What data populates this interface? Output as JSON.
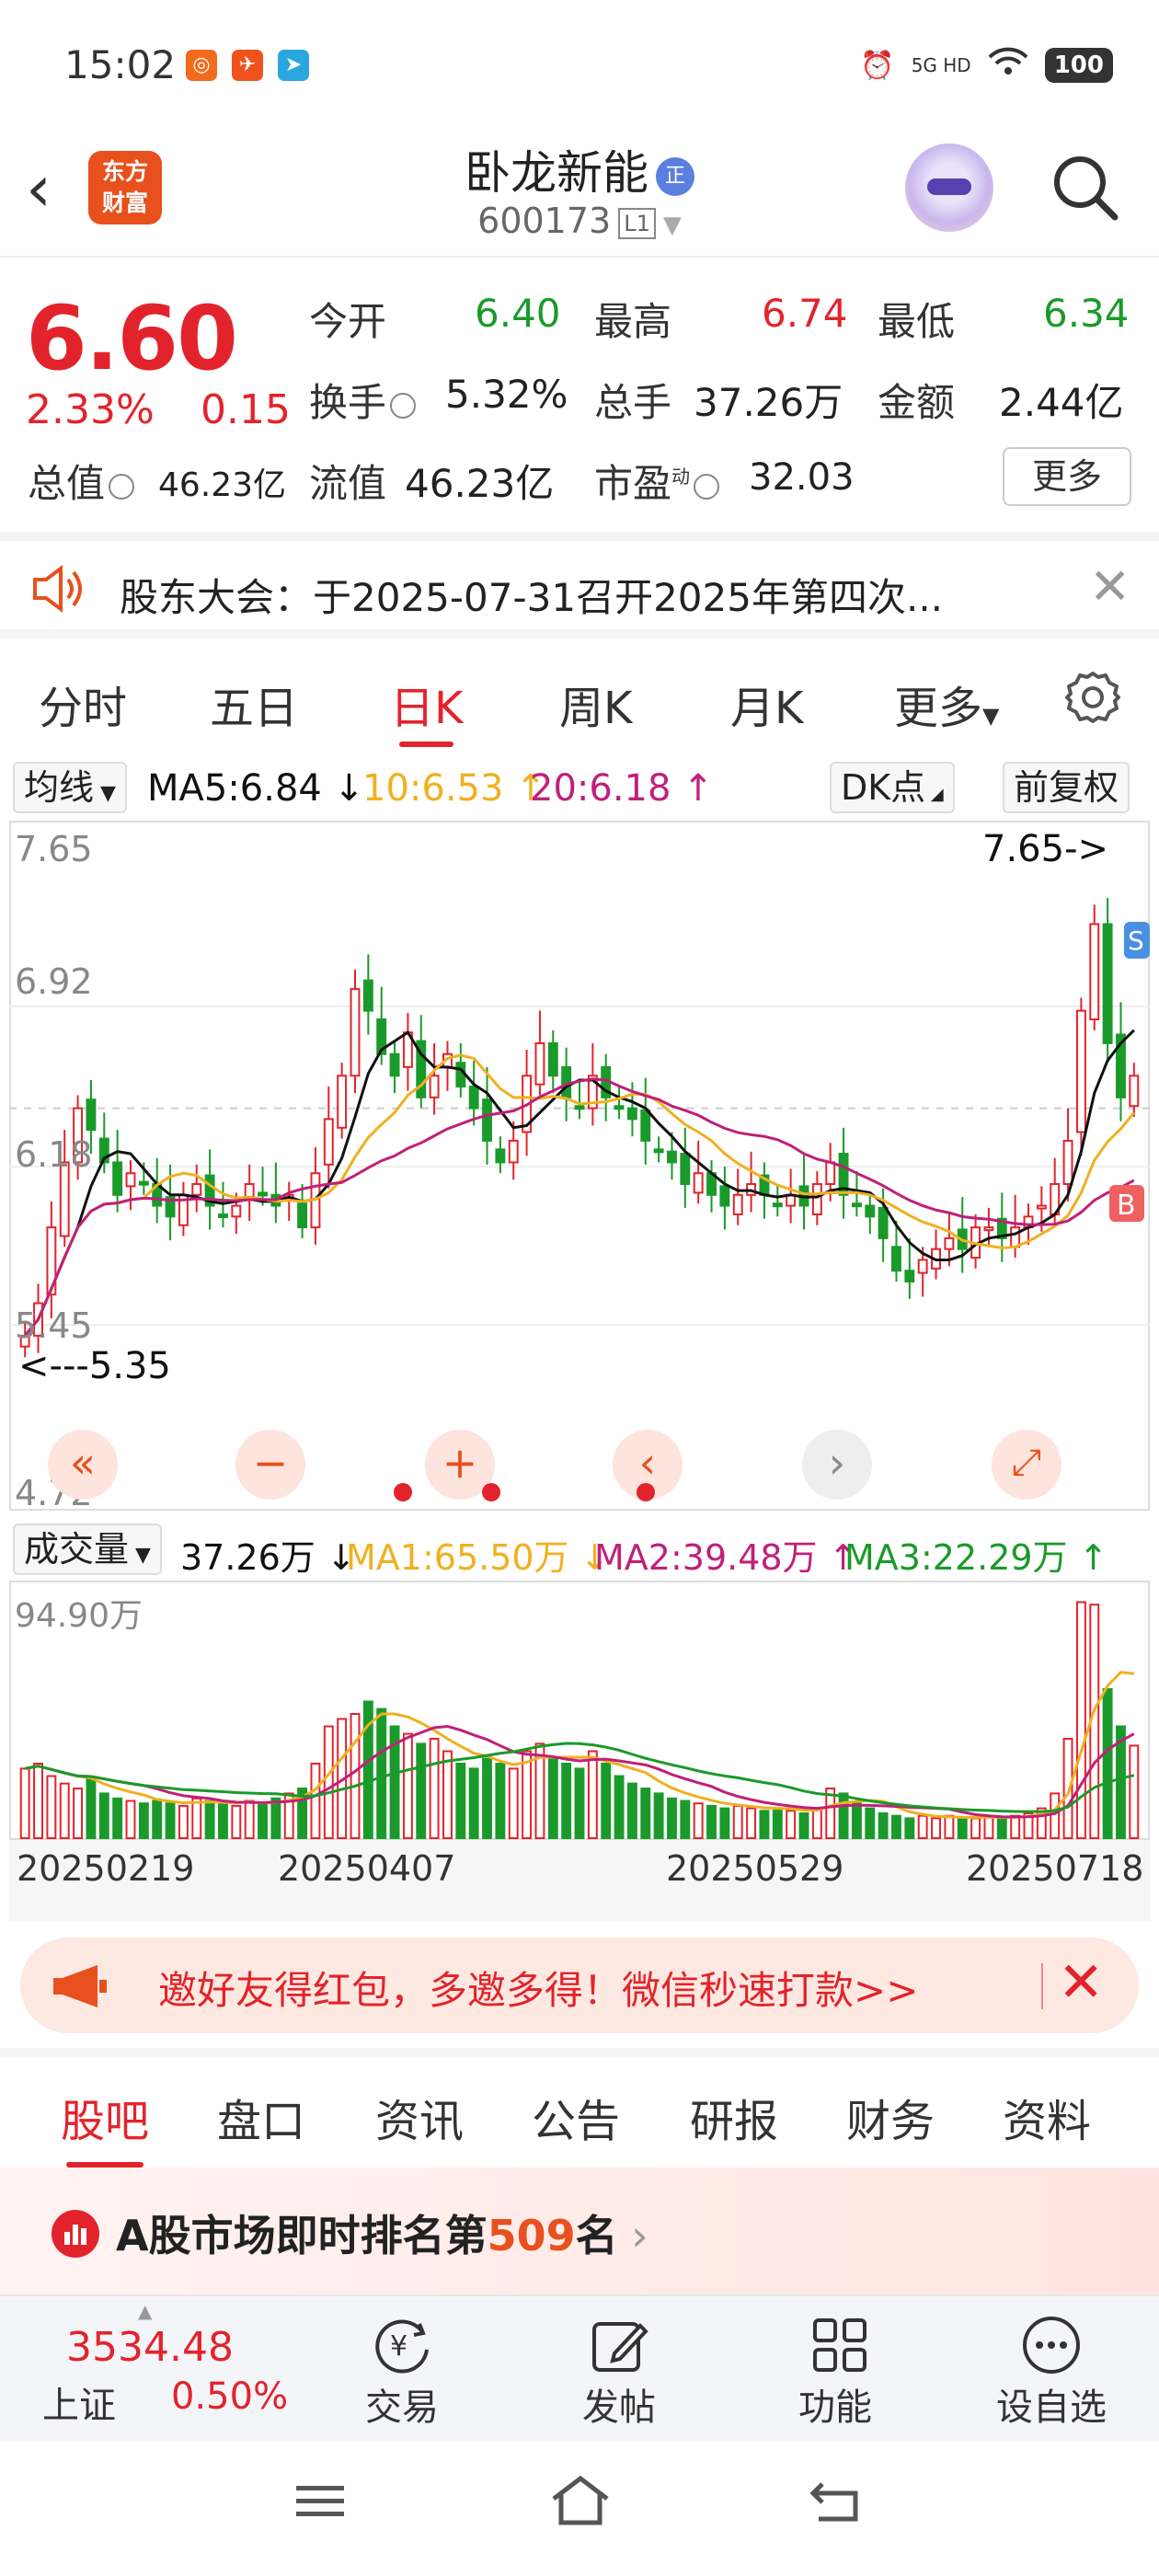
{
  "status_bar": {
    "time": "15:02",
    "network": "5G HD",
    "battery": "100"
  },
  "header": {
    "logo_text_1": "东方",
    "logo_text_2": "财富",
    "stock_name": "卧龙新能",
    "badge": "正",
    "stock_code": "600173",
    "level": "L1"
  },
  "quote": {
    "price": "6.60",
    "change_pct": "2.33%",
    "change": "0.15",
    "open_label": "今开",
    "open": "6.40",
    "high_label": "最高",
    "high": "6.74",
    "low_label": "最低",
    "low": "6.34",
    "turnover_label": "换手",
    "turnover": "5.32%",
    "volume_label": "总手",
    "volume": "37.26万",
    "amount_label": "金额",
    "amount": "2.44亿",
    "mktcap_label": "总值",
    "mktcap": "46.23亿",
    "float_label": "流值",
    "float_cap": "46.23亿",
    "pe_label": "市盈",
    "pe_sup": "动",
    "pe": "32.03",
    "more_label": "更多"
  },
  "notice": {
    "text": "股东大会：于2025-07-31召开2025年第四次..."
  },
  "chart_tabs": [
    "分时",
    "五日",
    "日K",
    "周K",
    "月K",
    "更多"
  ],
  "ma_row": {
    "selector": "均线",
    "ma5": "MA5:6.84 ↓",
    "ma10": "10:6.53 ↑",
    "ma20": "20:6.18 ↑",
    "dk": "DK点",
    "adjust": "前复权"
  },
  "price_axis": {
    "labels": [
      "7.65",
      "6.92",
      "6.18",
      "5.45",
      "4.72"
    ],
    "max_marker": "7.65->",
    "min_marker": "<---5.35",
    "s_mark": "S",
    "b_mark": "B"
  },
  "chart_controls": [
    "«",
    "−",
    "+",
    "‹",
    "›",
    "⤢"
  ],
  "volume_row": {
    "selector": "成交量",
    "vol": "37.26万 ↓",
    "ma1": "MA1:65.50万 ↓",
    "ma2": "MA2:39.48万 ↑",
    "ma3": "MA3:22.29万 ↑",
    "axis_max": "94.90万"
  },
  "dates": [
    "20250219",
    "20250407",
    "20250529",
    "20250718"
  ],
  "colors": {
    "up": "#e3232c",
    "down": "#1a9a2a",
    "ma5": "#111111",
    "ma10": "#f0b020",
    "ma20": "#c0207a",
    "accent": "#e8501d"
  },
  "invite": {
    "text": "邀好友得红包，多邀多得！微信秒速打款>>"
  },
  "bottom_tabs": [
    "股吧",
    "盘口",
    "资讯",
    "公告",
    "研报",
    "财务",
    "资料"
  ],
  "rank": {
    "prefix": "A股市场即时排名第",
    "number": "509",
    "suffix": "名"
  },
  "bottom_nav": {
    "index_value": "3534.48",
    "index_name": "上证",
    "index_pct": "0.50%",
    "items": [
      "交易",
      "发帖",
      "功能",
      "设自选"
    ]
  },
  "chart_data": {
    "type": "candlestick",
    "x_start": "20250219",
    "x_end": "20250718",
    "ylim": [
      4.72,
      7.65
    ],
    "y_ticks": [
      7.65,
      6.92,
      6.18,
      5.45,
      4.72
    ],
    "closes": [
      5.4,
      5.55,
      5.9,
      6.2,
      6.45,
      6.35,
      6.2,
      6.05,
      6.15,
      6.1,
      6.0,
      5.95,
      6.05,
      6.1,
      6.0,
      5.95,
      6.0,
      6.1,
      6.05,
      6.0,
      6.05,
      5.9,
      6.15,
      6.4,
      6.6,
      7.0,
      6.9,
      6.7,
      6.6,
      6.8,
      6.5,
      6.6,
      6.7,
      6.55,
      6.45,
      6.3,
      6.2,
      6.3,
      6.6,
      6.75,
      6.6,
      6.5,
      6.45,
      6.6,
      6.5,
      6.45,
      6.4,
      6.3,
      6.25,
      6.2,
      6.1,
      6.15,
      6.05,
      6.0,
      6.05,
      6.1,
      6.05,
      6.0,
      6.05,
      6.0,
      6.1,
      6.2,
      6.05,
      6.0,
      5.95,
      5.85,
      5.7,
      5.65,
      5.75,
      5.8,
      5.85,
      5.8,
      5.9,
      5.9,
      5.85,
      5.9,
      5.95,
      6.0,
      6.1,
      6.3,
      6.9,
      7.3,
      6.75,
      6.5,
      6.6
    ],
    "volumes_wan": [
      28,
      30,
      25,
      22,
      20,
      24,
      18,
      16,
      15,
      14,
      15,
      14,
      13,
      16,
      15,
      14,
      13,
      15,
      14,
      16,
      18,
      20,
      30,
      45,
      48,
      50,
      55,
      52,
      45,
      42,
      38,
      40,
      35,
      30,
      28,
      32,
      30,
      28,
      35,
      38,
      32,
      30,
      28,
      35,
      30,
      25,
      22,
      20,
      18,
      16,
      15,
      14,
      13,
      12,
      13,
      12,
      11,
      12,
      11,
      10,
      12,
      20,
      18,
      14,
      12,
      10,
      9,
      8,
      9,
      8,
      9,
      8,
      8,
      9,
      8,
      9,
      10,
      12,
      18,
      40,
      95,
      94,
      60,
      45,
      37.26
    ]
  }
}
